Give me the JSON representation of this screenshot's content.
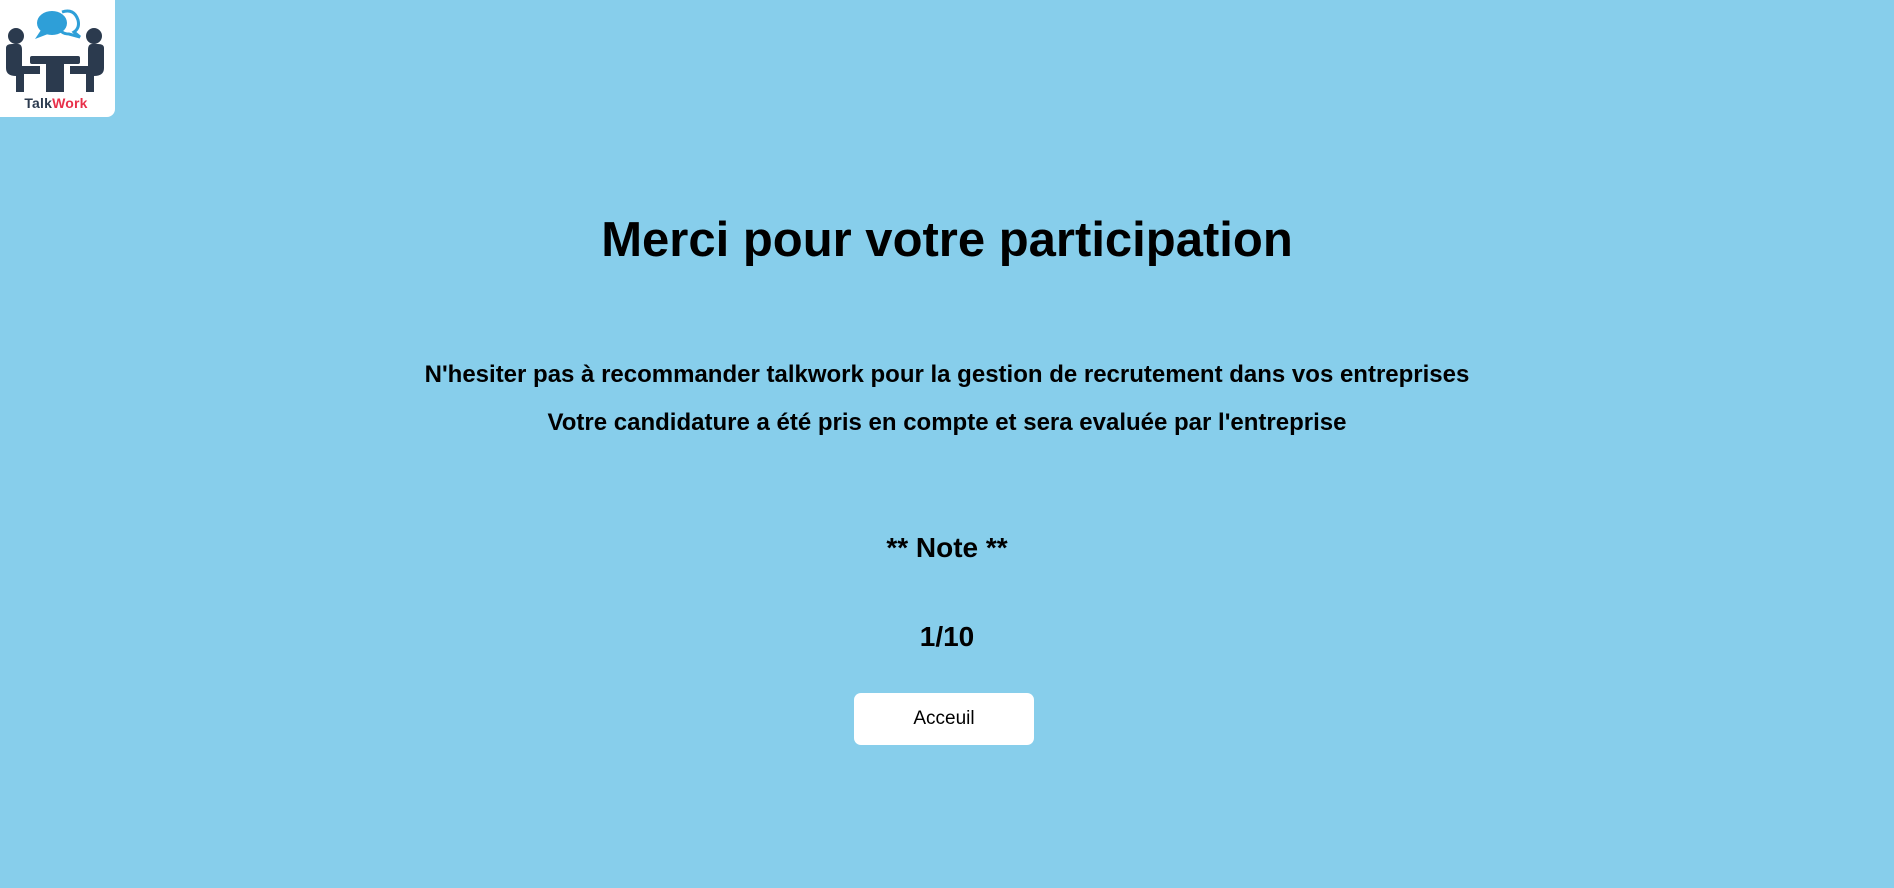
{
  "brand": {
    "name_part1": "Talk",
    "name_part2": "Work",
    "logo_icon": "meeting-people-chat-icon",
    "colors": {
      "dark": "#2b3a4e",
      "accent": "#e8304a",
      "bubble": "#2e9fd8"
    }
  },
  "page": {
    "background": "#87ceeb",
    "title": "Merci pour votre participation",
    "message1": "N'hesiter pas à recommander talkwork pour la gestion de recrutement dans vos entreprises",
    "message2": "Votre candidature a été pris en compte et sera evaluée par l'entreprise",
    "note_heading": "** Note **",
    "score": "1/10"
  },
  "actions": {
    "home_label": "Acceuil"
  }
}
